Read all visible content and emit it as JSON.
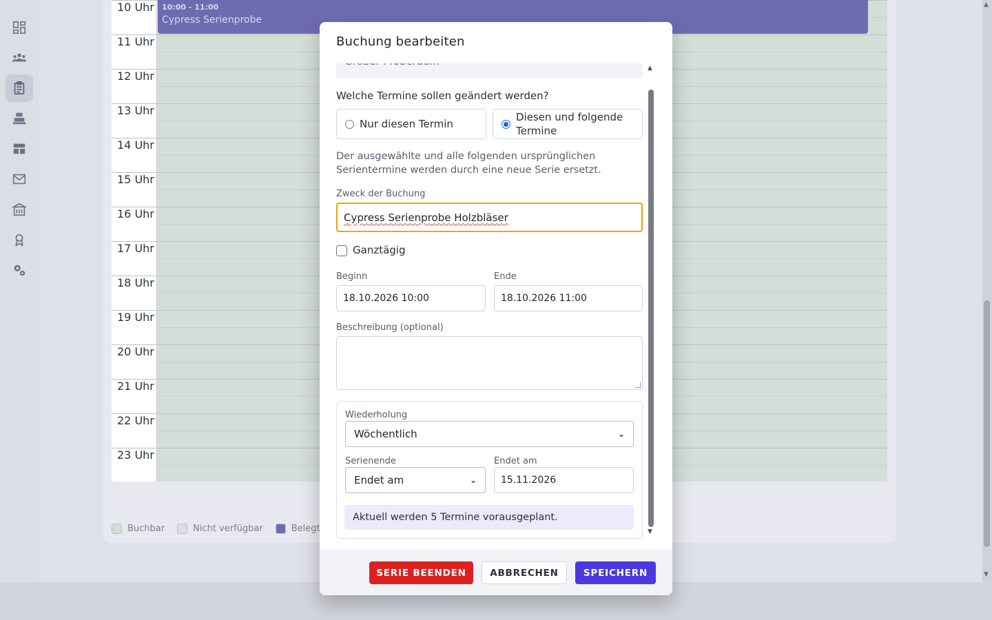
{
  "sidebar": {
    "items": [
      {
        "icon": "dashboard-icon"
      },
      {
        "icon": "people-icon"
      },
      {
        "icon": "clipboard-icon",
        "active": true
      },
      {
        "icon": "register-icon"
      },
      {
        "icon": "table-icon"
      },
      {
        "icon": "mail-icon"
      },
      {
        "icon": "building-icon"
      },
      {
        "icon": "award-icon"
      },
      {
        "icon": "settings-icon"
      }
    ]
  },
  "calendar": {
    "hours": [
      "10 Uhr",
      "11 Uhr",
      "12 Uhr",
      "13 Uhr",
      "14 Uhr",
      "15 Uhr",
      "16 Uhr",
      "17 Uhr",
      "18 Uhr",
      "19 Uhr",
      "20 Uhr",
      "21 Uhr",
      "22 Uhr",
      "23 Uhr"
    ],
    "event": {
      "time": "10:00 - 11:00",
      "title": "Cypress Serienprobe"
    },
    "legend": [
      {
        "label": "Buchbar",
        "color": "#d3ded9"
      },
      {
        "label": "Nicht verfügbar",
        "color": "#dcdee6"
      },
      {
        "label": "Belegt",
        "color": "#6e6cb0"
      }
    ]
  },
  "modal": {
    "title": "Buchung bearbeiten",
    "room_field_value": "Großer Proberaum",
    "question": "Welche Termine sollen geändert werden?",
    "options": [
      {
        "label": "Nur diesen Termin",
        "checked": false
      },
      {
        "label": "Diesen und folgende Termine",
        "checked": true
      }
    ],
    "info": "Der ausgewählte und alle folgenden ursprünglichen Serientermine werden durch eine neue Serie ersetzt.",
    "purpose": {
      "label": "Zweck der Buchung",
      "value": "Cypress Serienprobe Holzbläser"
    },
    "all_day": {
      "label": "Ganztägig",
      "checked": false
    },
    "start": {
      "label": "Beginn",
      "value": "18.10.2026 10:00"
    },
    "end": {
      "label": "Ende",
      "value": "18.10.2026 11:00"
    },
    "description": {
      "label": "Beschreibung (optional)",
      "value": ""
    },
    "repeat": {
      "label": "Wiederholung",
      "value": "Wöchentlich"
    },
    "series_end": {
      "label": "Serienende",
      "value": "Endet am"
    },
    "ends_on": {
      "label": "Endet am",
      "value": "15.11.2026"
    },
    "note": "Aktuell werden 5 Termine vorausgeplant.",
    "buttons": {
      "end_series": "SERIE BEENDEN",
      "cancel": "ABBRECHEN",
      "save": "SPEICHERN"
    }
  }
}
